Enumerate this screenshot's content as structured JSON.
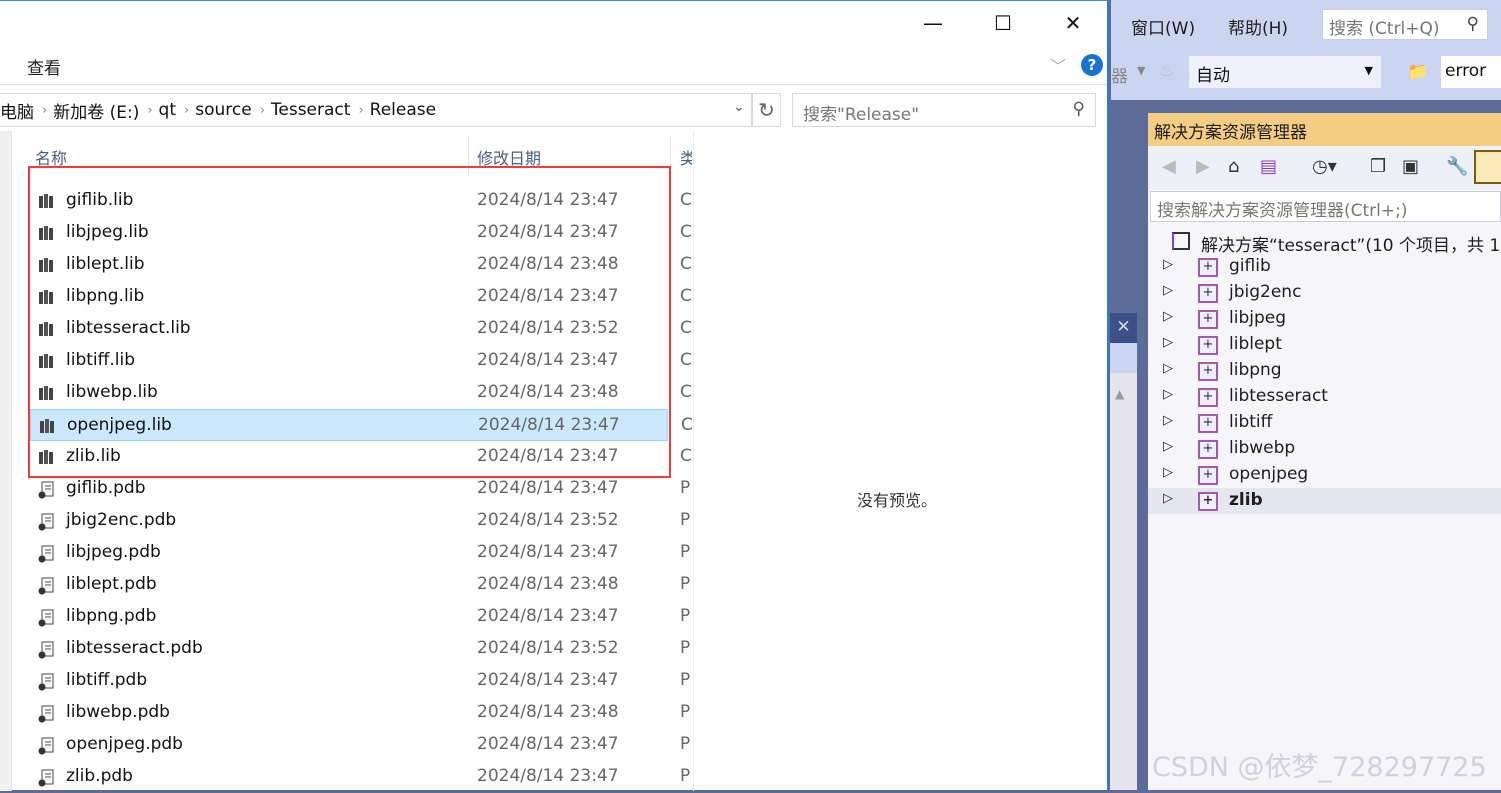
{
  "explorer": {
    "ribbon_tab": "查看",
    "breadcrumb": [
      "电脑",
      "新加卷 (E:)",
      "qt",
      "source",
      "Tesseract",
      "Release"
    ],
    "search_placeholder": "搜索\"Release\"",
    "columns": {
      "name": "名称",
      "date": "修改日期",
      "type": "类"
    },
    "files": [
      {
        "name": "giflib.lib",
        "date": "2024/8/14 23:47",
        "type": "C",
        "icon": "library-icon"
      },
      {
        "name": "libjpeg.lib",
        "date": "2024/8/14 23:47",
        "type": "C",
        "icon": "library-icon"
      },
      {
        "name": "liblept.lib",
        "date": "2024/8/14 23:48",
        "type": "C",
        "icon": "library-icon"
      },
      {
        "name": "libpng.lib",
        "date": "2024/8/14 23:47",
        "type": "C",
        "icon": "library-icon"
      },
      {
        "name": "libtesseract.lib",
        "date": "2024/8/14 23:52",
        "type": "C",
        "icon": "library-icon"
      },
      {
        "name": "libtiff.lib",
        "date": "2024/8/14 23:47",
        "type": "C",
        "icon": "library-icon"
      },
      {
        "name": "libwebp.lib",
        "date": "2024/8/14 23:48",
        "type": "C",
        "icon": "library-icon"
      },
      {
        "name": "openjpeg.lib",
        "date": "2024/8/14 23:47",
        "type": "C",
        "icon": "library-icon",
        "selected": true
      },
      {
        "name": "zlib.lib",
        "date": "2024/8/14 23:47",
        "type": "C",
        "icon": "library-icon"
      },
      {
        "name": "giflib.pdb",
        "date": "2024/8/14 23:47",
        "type": "P",
        "icon": "pdb-file-icon"
      },
      {
        "name": "jbig2enc.pdb",
        "date": "2024/8/14 23:52",
        "type": "P",
        "icon": "pdb-file-icon"
      },
      {
        "name": "libjpeg.pdb",
        "date": "2024/8/14 23:47",
        "type": "P",
        "icon": "pdb-file-icon"
      },
      {
        "name": "liblept.pdb",
        "date": "2024/8/14 23:48",
        "type": "P",
        "icon": "pdb-file-icon"
      },
      {
        "name": "libpng.pdb",
        "date": "2024/8/14 23:47",
        "type": "P",
        "icon": "pdb-file-icon"
      },
      {
        "name": "libtesseract.pdb",
        "date": "2024/8/14 23:52",
        "type": "P",
        "icon": "pdb-file-icon"
      },
      {
        "name": "libtiff.pdb",
        "date": "2024/8/14 23:47",
        "type": "P",
        "icon": "pdb-file-icon"
      },
      {
        "name": "libwebp.pdb",
        "date": "2024/8/14 23:48",
        "type": "P",
        "icon": "pdb-file-icon"
      },
      {
        "name": "openjpeg.pdb",
        "date": "2024/8/14 23:47",
        "type": "P",
        "icon": "pdb-file-icon"
      },
      {
        "name": "zlib.pdb",
        "date": "2024/8/14 23:47",
        "type": "P",
        "icon": "pdb-file-icon"
      }
    ],
    "preview_text": "没有预览。",
    "highlight_color": "#f03c3c"
  },
  "vs": {
    "menu": {
      "window": "窗口(W)",
      "help": "帮助(H)"
    },
    "quick_search": "搜索 (Ctrl+Q)",
    "toolbar": {
      "partial_label": "器",
      "config": "自动",
      "find": "error"
    },
    "solution_explorer": {
      "title": "解决方案资源管理器",
      "search_placeholder": "搜索解决方案资源管理器(Ctrl+;)",
      "solution": "解决方案“tesseract”(10 个项目，共 1",
      "projects": [
        "giflib",
        "jbig2enc",
        "libjpeg",
        "liblept",
        "libpng",
        "libtesseract",
        "libtiff",
        "libwebp",
        "openjpeg",
        "zlib"
      ],
      "selected_project": "zlib"
    }
  },
  "watermark": "CSDN @依梦_728297725"
}
